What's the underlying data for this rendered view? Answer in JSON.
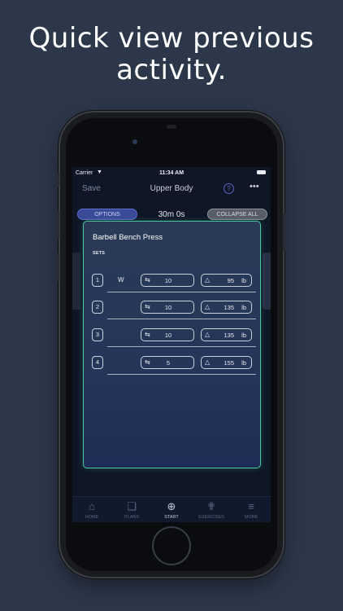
{
  "headline": {
    "line1": "Quick view previous",
    "line2": "activity."
  },
  "status_bar": {
    "carrier": "Carrier",
    "time": "11:34 AM"
  },
  "nav": {
    "save_label": "Save",
    "title": "Upper Body",
    "help": "?",
    "more": "•••"
  },
  "toolbar": {
    "options_label": "OPTIONS",
    "timer": "30m 0s",
    "collapse_label": "COLLAPSE ALL"
  },
  "exercise_card": {
    "title": "Barbell Bench Press",
    "sets_label": "SETS",
    "sets": [
      {
        "number": "1",
        "type": "W",
        "reps": "10",
        "weight": "95",
        "unit": "lb"
      },
      {
        "number": "2",
        "type": "",
        "reps": "10",
        "weight": "135",
        "unit": "lb"
      },
      {
        "number": "3",
        "type": "",
        "reps": "10",
        "weight": "135",
        "unit": "lb"
      },
      {
        "number": "4",
        "type": "",
        "reps": "5",
        "weight": "155",
        "unit": "lb"
      }
    ]
  },
  "tab_bar": {
    "tabs": [
      {
        "label": "HOME",
        "icon": "home-icon"
      },
      {
        "label": "PLANS",
        "icon": "plans-icon"
      },
      {
        "label": "START",
        "icon": "start-icon"
      },
      {
        "label": "EXERCISES",
        "icon": "exercises-icon"
      },
      {
        "label": "MORE",
        "icon": "menu-icon"
      }
    ],
    "active": "START"
  },
  "colors": {
    "background": "#2d374a",
    "card_border": "#48c9a0",
    "accent": "#3a4a99"
  }
}
